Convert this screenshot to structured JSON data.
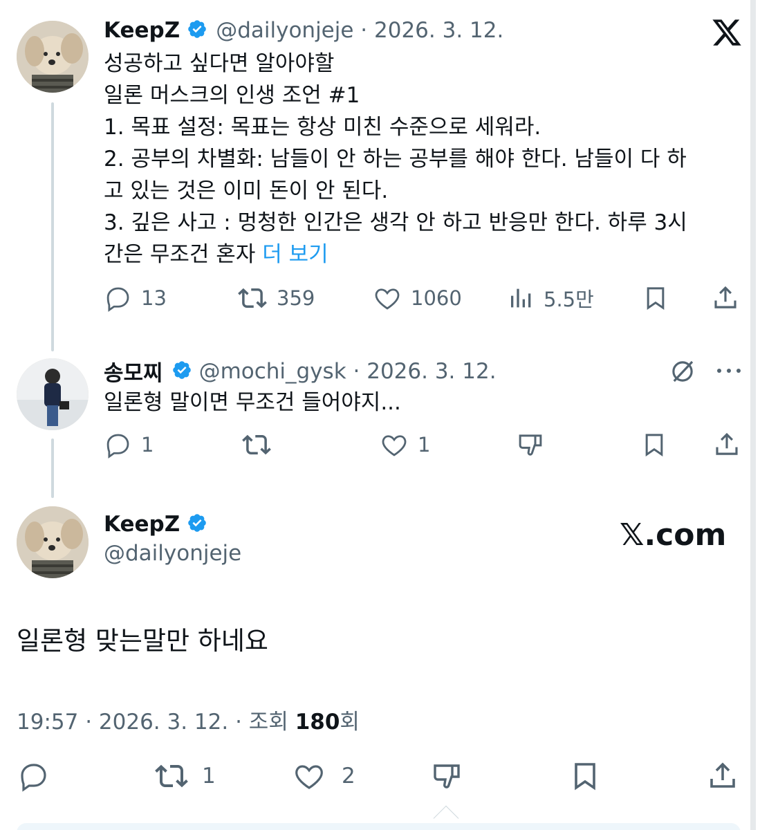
{
  "brand": {
    "x_logo_text": "𝕏",
    "xcom_text": "𝕏.com"
  },
  "colors": {
    "accent": "#1d9bf0",
    "muted": "#536471",
    "text": "#0f1419",
    "line": "#cfd9de"
  },
  "tweet1": {
    "author_name": "KeepZ",
    "meta": "@dailyonjeje · 2026. 3. 12.",
    "lines": [
      "성공하고 싶다면 알아야할",
      "일론 머스크의 인생 조언 #1",
      "1. 목표 설정: 목표는 항상 미친 수준으로 세워라.",
      "2. 공부의 차별화: 남들이 안 하는 공부를 해야 한다. 남들이 다 하",
      "고 있는 것은 이미 돈이 안 된다.",
      "3. 깊은 사고 : 멍청한 인간은 생각 안 하고 반응만 한다. 하루 3시"
    ],
    "last_line": "간은 무조건 혼자",
    "more": "더 보기",
    "stats": {
      "replies": "13",
      "retweets": "359",
      "likes": "1060",
      "views": "5.5만"
    }
  },
  "tweet2": {
    "author_name": "송모찌",
    "meta": "@mochi_gysk · 2026. 3. 12.",
    "text": "일론형 말이면 무조건 들어야지...",
    "stats": {
      "replies": "1",
      "retweets": "",
      "likes": "1"
    }
  },
  "main": {
    "author_name": "KeepZ",
    "handle": "@dailyonjeje",
    "text": "일론형 맞는말만 하네요",
    "timestamp": "19:57 · 2026. 3. 12. · 조회 ",
    "views_count": "180",
    "views_suffix": "회",
    "stats": {
      "retweets": "1",
      "likes": "2"
    }
  }
}
